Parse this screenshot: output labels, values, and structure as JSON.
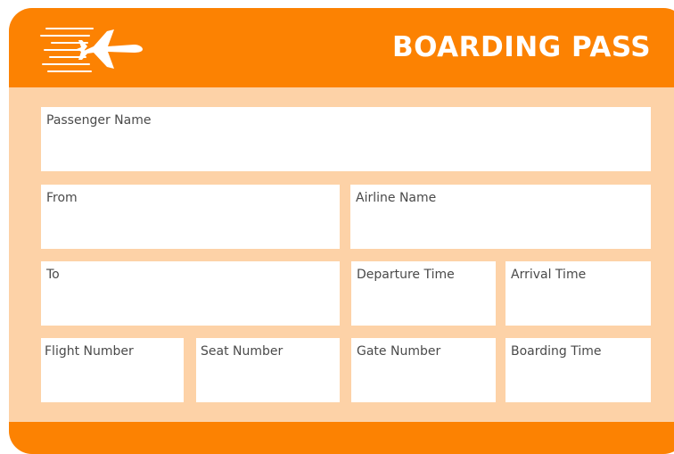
{
  "colors": {
    "primary": "#fc8202",
    "card_background": "#fdd2a7",
    "field_background": "#ffffff",
    "label_text": "#4a4a4a"
  },
  "header": {
    "title": "BOARDING PASS",
    "icon": "airplane-icon"
  },
  "fields": {
    "passenger_name": "Passenger Name",
    "from": "From",
    "airline_name": "Airline Name",
    "to": "To",
    "departure_time": "Departure Time",
    "arrival_time": "Arrival Time",
    "flight_number": "Flight Number",
    "seat_number": "Seat Number",
    "gate_number": "Gate Number",
    "boarding_time": "Boarding Time"
  }
}
